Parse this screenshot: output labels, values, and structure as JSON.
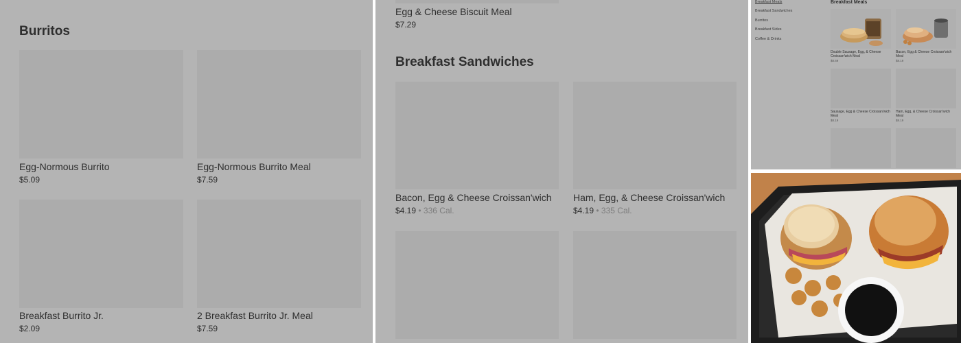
{
  "left": {
    "section_title": "Burritos",
    "items": [
      {
        "name": "Egg-Normous Burrito",
        "price": "$5.09"
      },
      {
        "name": "Egg-Normous Burrito Meal",
        "price": "$7.59"
      },
      {
        "name": "Breakfast Burrito Jr.",
        "price": "$2.09"
      },
      {
        "name": "2 Breakfast Burrito Jr. Meal",
        "price": "$7.59"
      }
    ]
  },
  "middle": {
    "top_item": {
      "name": "Egg & Cheese Biscuit Meal",
      "price": "$7.29"
    },
    "section_title": "Breakfast Sandwiches",
    "items": [
      {
        "name": "Bacon, Egg & Cheese Croissan'wich",
        "price": "$4.19",
        "separator": "•",
        "calories": "336 Cal."
      },
      {
        "name": "Ham, Egg, & Cheese Croissan'wich",
        "price": "$4.19",
        "separator": "•",
        "calories": "335 Cal."
      }
    ]
  },
  "mini": {
    "nav": [
      "Breakfast Meals",
      "Breakfast Sandwiches",
      "Burritos",
      "Breakfast Sides",
      "Coffee & Drinks"
    ],
    "section_title": "Breakfast Meals",
    "items": [
      {
        "name": "Double Sausage, Egg, & Cheese Croissan'wich Meal",
        "price": "$8.69"
      },
      {
        "name": "Bacon, Egg & Cheese Croissan'wich Meal",
        "price": "$8.19"
      },
      {
        "name": "Sausage, Egg & Cheese Croissan'wich Meal",
        "price": "$8.19"
      },
      {
        "name": "Ham, Egg, & Cheese Croissan'wich Meal",
        "price": "$8.19"
      }
    ]
  },
  "colors": {
    "panel_bg": "#b4b4b4",
    "placeholder": "#acacac",
    "text": "#2e2e2e",
    "muted": "#7d7d7d"
  }
}
